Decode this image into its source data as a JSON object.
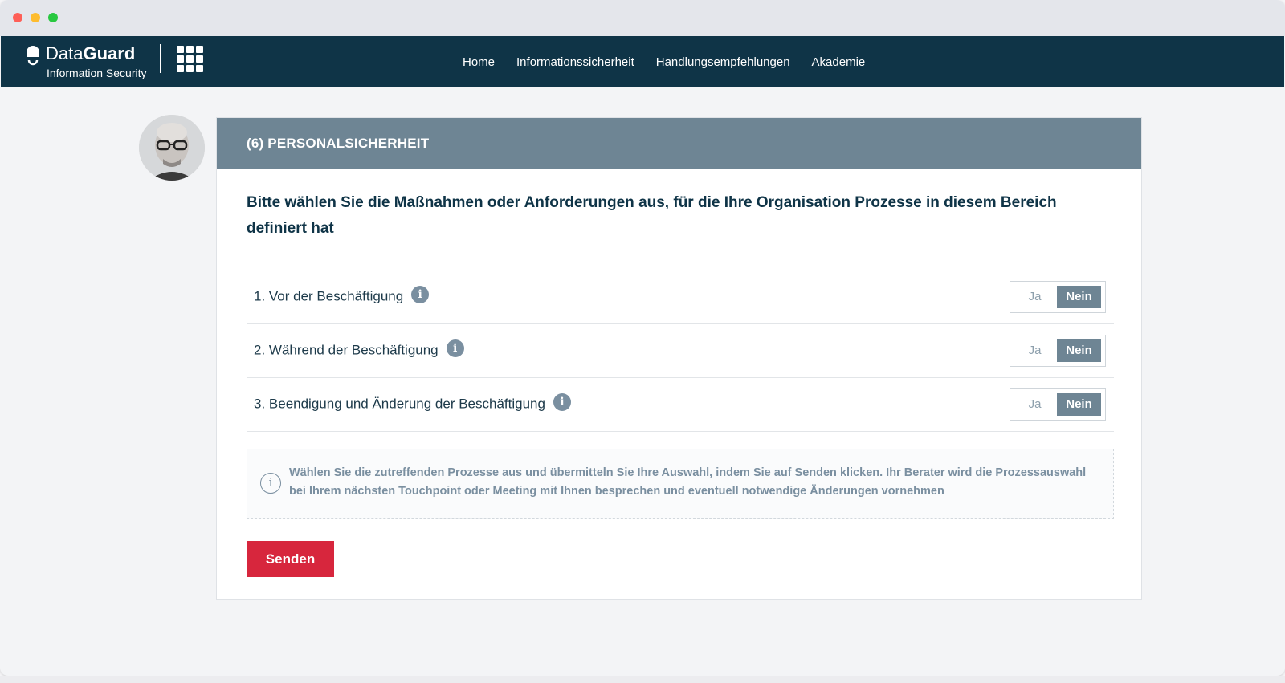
{
  "navbar": {
    "brand_light": "Data",
    "brand_bold": "Guard",
    "brand_sub": "Information Security",
    "links": [
      "Home",
      "Informationssicherheit",
      "Handlungsempfehlungen",
      "Akademie"
    ]
  },
  "card": {
    "header": "(6) PERSONALSICHERHEIT",
    "question": "Bitte wählen Sie die Maßnahmen oder Anforderungen aus, für die Ihre Organisation Prozesse in diesem Bereich definiert hat",
    "items": [
      {
        "label": "1. Vor der Beschäftigung",
        "yes": "Ja",
        "no": "Nein",
        "selected": "Nein"
      },
      {
        "label": "2. Während der Beschäftigung",
        "yes": "Ja",
        "no": "Nein",
        "selected": "Nein"
      },
      {
        "label": "3. Beendigung und Änderung der Beschäftigung",
        "yes": "Ja",
        "no": "Nein",
        "selected": "Nein"
      }
    ],
    "info_glyph": "i",
    "notice": "Wählen Sie die zutreffenden Prozesse aus und übermitteln Sie Ihre Auswahl, indem Sie auf Senden klicken. Ihr Berater wird die Prozessauswahl bei Ihrem nächsten Touchpoint oder Meeting mit Ihnen besprechen und eventuell notwendige Änderungen vornehmen",
    "send_label": "Senden"
  },
  "colors": {
    "navbar_bg": "#0f3447",
    "header_bg": "#6e8594",
    "send_bg": "#d7263d"
  }
}
